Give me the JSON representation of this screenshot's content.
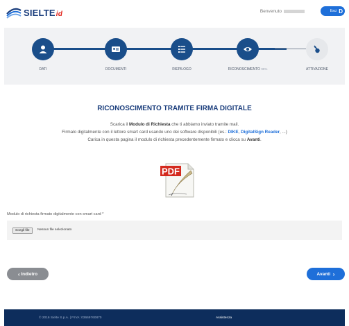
{
  "header": {
    "logo_text": "SIELTE",
    "logo_suffix": "id",
    "welcome_label": "Benvenuto",
    "exit_label": "Esci",
    "exit_icon": "door-exit-icon"
  },
  "steps": [
    {
      "label": "DATI",
      "icon": "user-icon",
      "state": "done"
    },
    {
      "label": "DOCUMENTI",
      "icon": "id-card-icon",
      "state": "done"
    },
    {
      "label": "RIEPILOGO",
      "icon": "list-icon",
      "state": "done"
    },
    {
      "label": "RICONOSCIMENTO",
      "pct": "95%",
      "icon": "eye-icon",
      "state": "active"
    },
    {
      "label": "ATTIVAZIONE",
      "icon": "key-icon",
      "state": "pending"
    }
  ],
  "main": {
    "title": "RICONOSCIMENTO TRAMITE FIRMA DIGITALE",
    "line1_pre": "Scarica il ",
    "line1_bold": "Modulo di Richiesta",
    "line1_post": " che ti abbiamo inviato tramite mail.",
    "line2_pre": "Firmalo digitalmente con il lettore smart card usando uno dei software disponibili (es.: ",
    "line2_link1": "DIKE",
    "line2_sep": ", ",
    "line2_link2": "DigitalSign Reader",
    "line2_post": ", ...)",
    "line3_pre": "Carica in questa pagina il modulo di richiesta precedentemente firmato e clicca su ",
    "line3_bold": "Avanti",
    "line3_post": ".",
    "pdf_icon_label": "PDF"
  },
  "upload": {
    "label": "Modulo di richiesta firmato digitalmente con smart card *",
    "button_label": "Scegli file",
    "status": "Nessun file selezionato"
  },
  "nav": {
    "back_label": "Indietro",
    "next_label": "Avanti"
  },
  "footer": {
    "copyright": "© 2016 Sielte S.p.A. | P.IVA: 03669760870",
    "help_link": "Assistenza"
  },
  "colors": {
    "primary": "#1a4e8a",
    "accent": "#1e6fd9",
    "footer_bg": "#0d2d5c",
    "back_button": "#8a8d92"
  }
}
